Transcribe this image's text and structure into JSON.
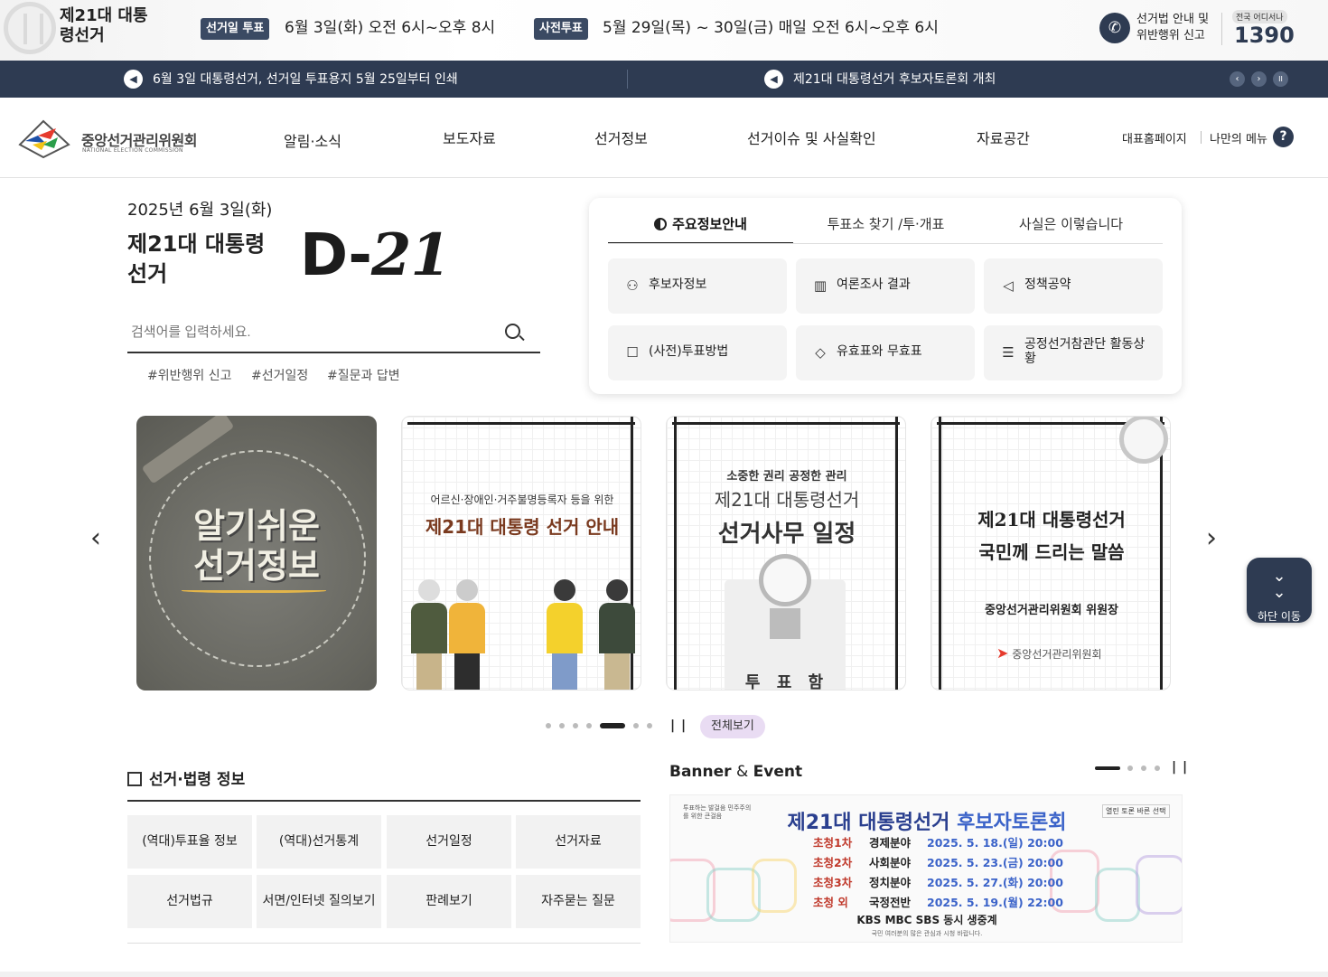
{
  "topbar": {
    "title": "제21대 대통령선거",
    "election_day_badge": "선거일 투표",
    "election_day_text": "6월 3일(화) 오전 6시~오후 8시",
    "early_badge": "사전투표",
    "early_text": "5월 29일(목) ~ 30일(금) 매일 오전 6시~오후 6시",
    "report_text": "선거법 안내 및 위반행위 신고",
    "hotline_label": "전국 어디서나",
    "hotline_number": "1390"
  },
  "notices": {
    "left": "6월 3일 대통령선거, 선거일 투표용지 5월 25일부터 인쇄",
    "right": "제21대 대통령선거 후보자토론회 개최",
    "prev": "‹",
    "next": "›",
    "pause": "II"
  },
  "header": {
    "logo_name": "중앙선거관리위원회",
    "logo_en": "NATIONAL ELECTION COMMISSION",
    "nav": [
      "알림·소식",
      "보도자료",
      "선거정보",
      "선거이슈 및 사실확인",
      "자료공간"
    ],
    "util_home": "대표홈페이지",
    "util_menu": "나만의 메뉴",
    "help": "?"
  },
  "hero": {
    "date": "2025년 6월 3일(화)",
    "election_title": "제21대 대통령선거",
    "dday_prefix": "D-",
    "dday_number": "21",
    "search_placeholder": "검색어를 입력하세요.",
    "tags": [
      "#위반행위 신고",
      "#선거일정",
      "#질문과 답변"
    ]
  },
  "info_panel": {
    "tabs": [
      "주요정보안내",
      "투표소 찾기 /투·개표",
      "사실은 이렇습니다"
    ],
    "buttons": [
      {
        "label": "후보자정보",
        "icon": "person-icon"
      },
      {
        "label": "여론조사 결과",
        "icon": "bar-chart-icon"
      },
      {
        "label": "정책공약",
        "icon": "megaphone-icon"
      },
      {
        "label": "(사전)투표방법",
        "icon": "ballot-box-icon"
      },
      {
        "label": "유효표와 무효표",
        "icon": "stamp-icon"
      },
      {
        "label": "공정선거참관단 활동상황",
        "icon": "document-icon"
      }
    ]
  },
  "carousel": {
    "card1": "알기쉬운 선거정보",
    "card2_sub": "어르신·장애인·거주불명등록자 등을 위한",
    "card2_title": "제21대 대통령 선거 안내",
    "card3_sub": "소중한 권리 공정한 관리",
    "card3_title1": "제21대 대통령선거",
    "card3_title2": "선거사무 일정",
    "card3_box": "투 표 함",
    "card4_line1": "제21대 대통령선거",
    "card4_line2": "국민께 드리는 말씀",
    "card4_sign": "중앙선거관리위원회 위원장",
    "card4_logo": "중앙선거관리위원회",
    "view_all": "전체보기",
    "prev": "‹",
    "next": "›"
  },
  "down_button": "하단 이동",
  "law": {
    "title": "선거·법령 정보",
    "items": [
      "(역대)투표율 정보",
      "(역대)선거통계",
      "선거일정",
      "선거자료",
      "선거법규",
      "서면/인터넷 질의보기",
      "판례보기",
      "자주묻는 질문"
    ]
  },
  "banner_event": {
    "title_en1": "Banner",
    "title_amp": " & ",
    "title_en2": "Event",
    "small": "투표하는 발걸음 민주주의를 위한 큰걸음",
    "tag": "열린 토론 바른 선택",
    "headline1": "제21대 대통령선거 ",
    "headline2": "후보자토론회",
    "rows": [
      {
        "round": "초청1차",
        "field": "경제분야",
        "date": "2025. 5. 18.(일) 20:00"
      },
      {
        "round": "초청2차",
        "field": "사회분야",
        "date": "2025. 5. 23.(금) 20:00"
      },
      {
        "round": "초청3차",
        "field": "정치분야",
        "date": "2025. 5. 27.(화) 20:00"
      },
      {
        "round": "초청 외",
        "field": "국정전반",
        "date": "2025. 5. 19.(월) 22:00"
      }
    ],
    "broadcast": "KBS MBC SBS 동시 생중계",
    "note": "국민 여러분의 많은 관심과 시청 바랍니다."
  }
}
